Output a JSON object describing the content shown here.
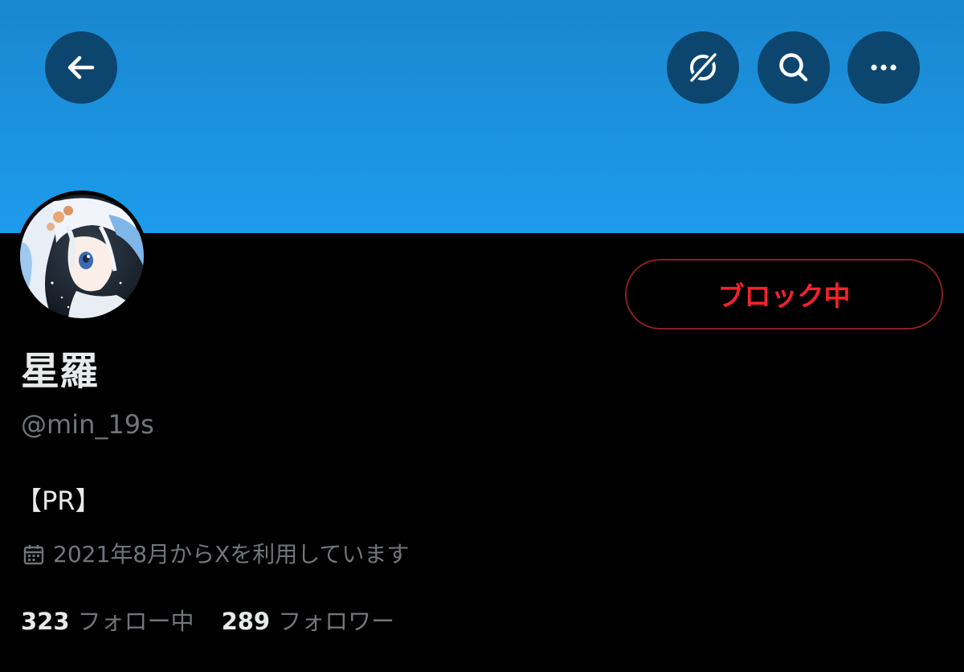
{
  "header": {
    "icons": [
      "back-arrow-icon",
      "grok-icon",
      "search-icon",
      "more-icon"
    ],
    "banner_color": "#1d9bec"
  },
  "profile": {
    "display_name": "星羅",
    "handle": "@min_19s",
    "bio": "【PR】",
    "joined": "2021年8月からXを利用しています",
    "block_button_label": "ブロック中",
    "following_count": "323",
    "following_label": "フォロー中",
    "followers_count": "289",
    "followers_label": "フォロワー"
  },
  "colors": {
    "block_red": "#f4212e",
    "text_primary": "#e7e9ea",
    "text_secondary": "#71767b",
    "button_bg": "#0c466e"
  }
}
